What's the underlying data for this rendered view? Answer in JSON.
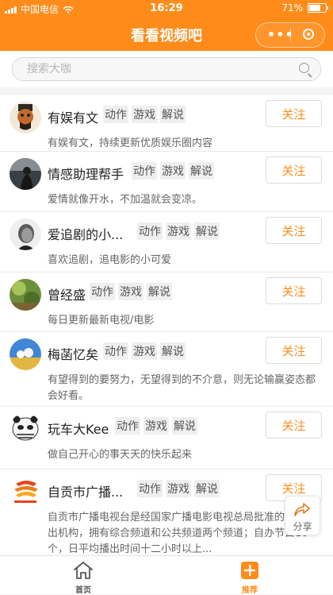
{
  "status_bar": {
    "carrier": "中国电信",
    "time": "16:29",
    "battery": "71%"
  },
  "nav": {
    "title": "看看视频吧",
    "more_icon": "ellipsis-icon",
    "close_icon": "target-icon"
  },
  "search": {
    "placeholder": "搜索大咖",
    "value": "",
    "icon": "search-icon"
  },
  "follow_label": "关注",
  "colors": {
    "accent": "#ff8c1a",
    "tab_active": "#ff8c1a",
    "tab_inactive": "#555555"
  },
  "items": [
    {
      "name": "有娱有文",
      "tags": [
        "动作",
        "游戏",
        "解说"
      ],
      "desc": "有娱有文，持续更新优质娱乐圈内容"
    },
    {
      "name": "情感助理帮手",
      "tags": [
        "动作",
        "游戏",
        "解说"
      ],
      "desc": "爱情就像开水，不加温就会变凉。"
    },
    {
      "name": "爱追剧的小...",
      "tags": [
        "动作",
        "游戏",
        "解说"
      ],
      "desc": "喜欢追剧，追电影的小可爱"
    },
    {
      "name": "曾经盛",
      "tags": [
        "动作",
        "游戏",
        "解说"
      ],
      "desc": "每日更新最新电视/电影"
    },
    {
      "name": "梅菡忆矣",
      "tags": [
        "动作",
        "游戏",
        "解说"
      ],
      "desc": "有望得到的要努力，无望得到的不介意，则无论输赢姿态都会好看。"
    },
    {
      "name": "玩车大Kee",
      "tags": [
        "动作",
        "游戏",
        "解说"
      ],
      "desc": "做自己开心的事天天的快乐起来"
    },
    {
      "name": "自贡市广播...",
      "tags": [
        "动作",
        "游戏",
        "解说"
      ],
      "desc": "自贡市广播电视台是经国家广播电影电视总局批准的电视播出机构，拥有综合频道和公共频道两个频道；自办节目10个，日平均播出时间十二小时以上..."
    }
  ],
  "share": {
    "label": "分享",
    "icon": "share-arrow-icon"
  },
  "tabs": [
    {
      "label": "首页",
      "icon": "home-icon"
    },
    {
      "label": "推荐",
      "icon": "plus-icon"
    }
  ]
}
